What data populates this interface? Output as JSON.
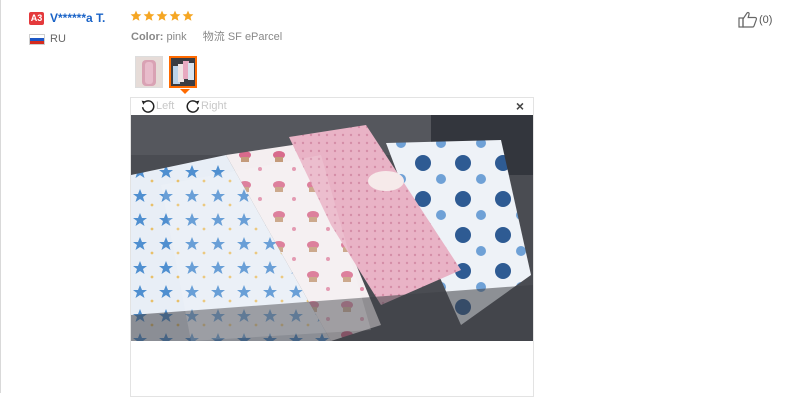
{
  "review": {
    "badge": "A3",
    "username": "V******a T.",
    "country": "RU",
    "rating": 5,
    "color_label": "Color:",
    "color_value": "pink",
    "shipping_label": "物流",
    "shipping_value": "SF eParcel",
    "likes": "(0)"
  },
  "viewer": {
    "rotate_left": "Left",
    "rotate_right": "Right",
    "close": "×"
  },
  "colors": {
    "username": "#1a63c7",
    "badge": "#e4393c",
    "stars": "#f5a623",
    "active_thumb": "#ff6a00"
  }
}
